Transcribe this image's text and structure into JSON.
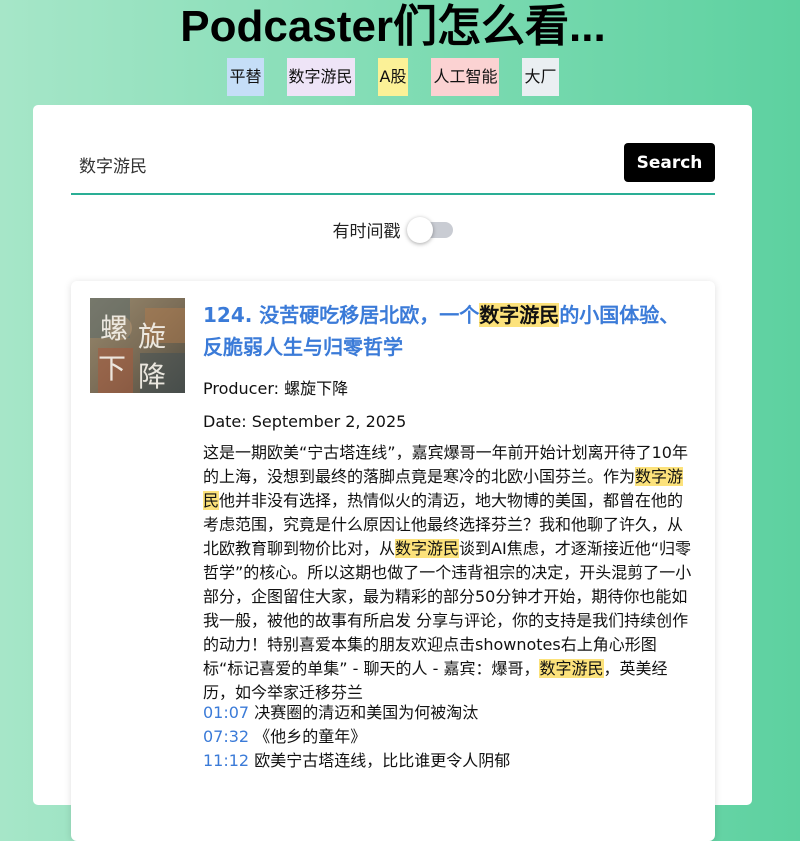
{
  "header": {
    "title": "Podcaster们怎么看..."
  },
  "tags": [
    {
      "label": "平替",
      "color": "#c5def7"
    },
    {
      "label": "数字游民",
      "color": "#eee4f7"
    },
    {
      "label": "A股",
      "color": "#fbf197"
    },
    {
      "label": "人工智能",
      "color": "#fbd2d2"
    },
    {
      "label": "大厂",
      "color": "#eaeff2"
    }
  ],
  "search": {
    "value": "数字游民",
    "button_label": "Search"
  },
  "timestamp_filter": {
    "label": "有时间戳",
    "enabled": false
  },
  "result": {
    "cover_text": "螺旋下降",
    "title_parts": [
      "124. 没苦硬吃移居北欧，一个",
      "数字游民",
      "的小国体验、反脆弱人生与归零哲学"
    ],
    "producer": "Producer: 螺旋下降",
    "date": "Date: September 2, 2025",
    "description_parts": [
      "这是一期欧美“宁古塔连线”，嘉宾爆哥一年前开始计划离开待了10年的上海，没想到最终的落脚点竟是寒冷的北欧小国芬兰。作为",
      "数字游民",
      "他并非没有选择，热情似火的清迈，地大物博的美国，都曾在他的考虑范围，究竟是什么原因让他最终选择芬兰？我和他聊了许久，从北欧教育聊到物价比对，从",
      "数字游民",
      "谈到AI焦虑，才逐渐接近他“归零哲学”的核心。所以这期也做了一个违背祖宗的决定，开头混剪了一小部分，企图留住大家，最为精彩的部分50分钟才开始，期待你也能如我一般，被他的故事有所启发 分享与评论，你的支持是我们持续创作的动力！特别喜爱本集的朋友欢迎点击shownotes右上角心形图标“标记喜爱的单集” - 聊天的人 - 嘉宾：爆哥，",
      "数字游民",
      "，英美经历，如今举家迁移芬兰"
    ],
    "timestamps": [
      {
        "time": "01:07",
        "text": "决赛圈的清迈和美国为何被淘汰"
      },
      {
        "time": "07:32",
        "text": "《他乡的童年》"
      },
      {
        "time": "11:12",
        "text": "欧美宁古塔连线，比比谁更令人阴郁"
      }
    ]
  },
  "colors": {
    "accent_underline": "#2aae95",
    "title_link": "#3b7bd8",
    "highlight": "#fce27b",
    "button_bg": "#000000"
  }
}
